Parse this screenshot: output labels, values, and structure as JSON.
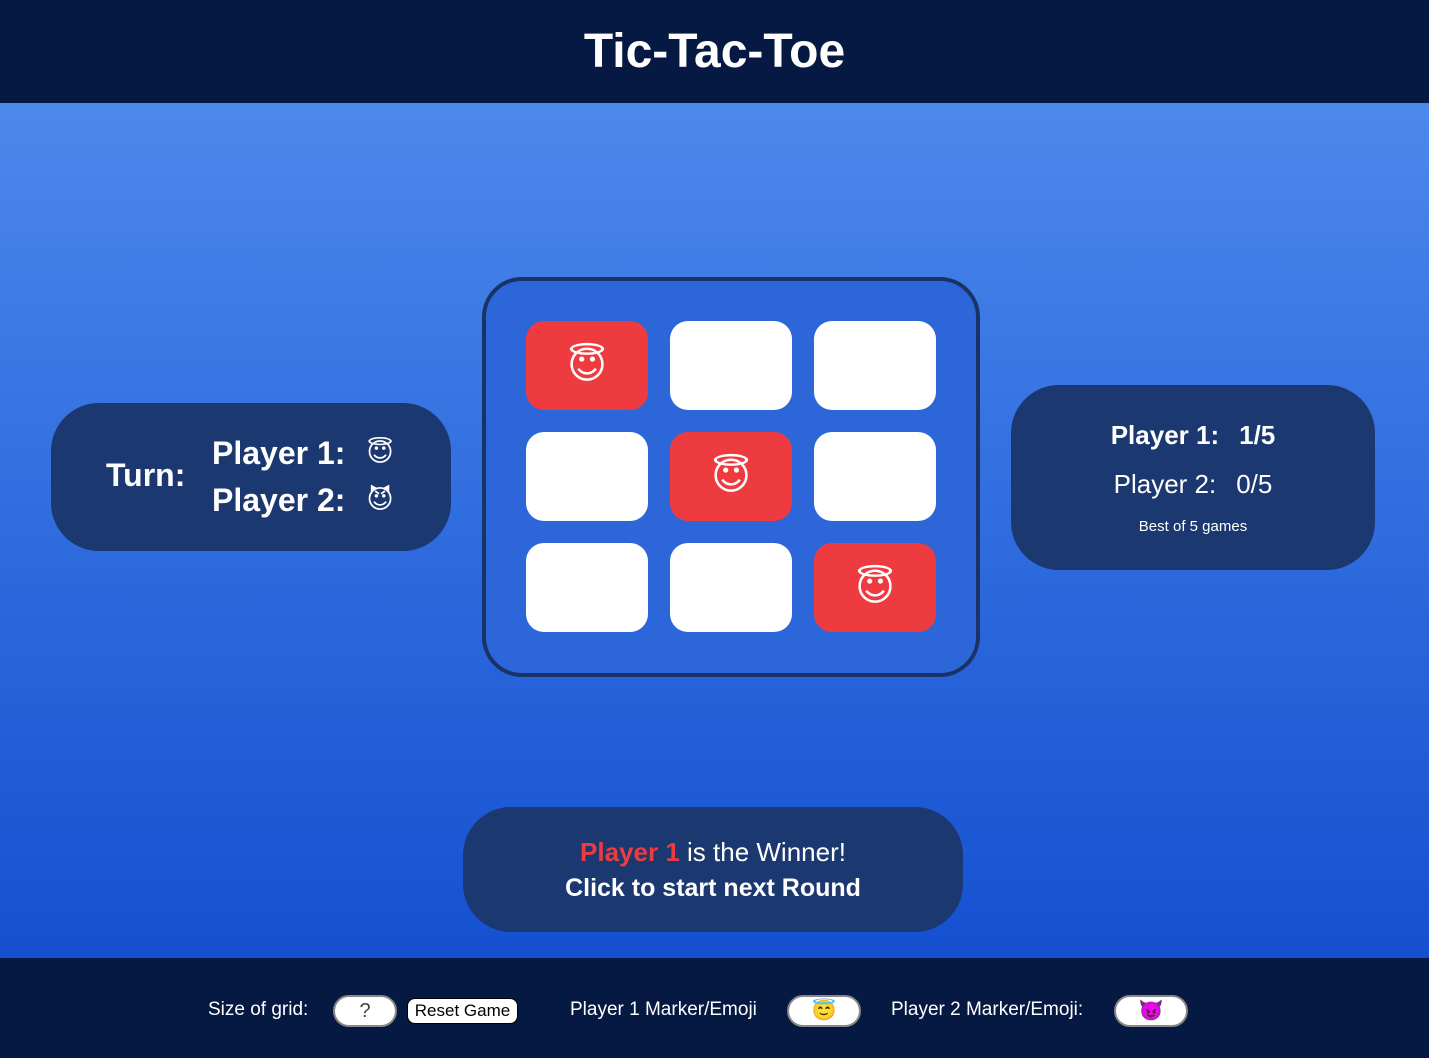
{
  "header": {
    "title": "Tic-Tac-Toe"
  },
  "turn": {
    "label": "Turn:",
    "players": [
      {
        "label": "Player 1:",
        "emoji": "😇"
      },
      {
        "label": "Player 2:",
        "emoji": "😈"
      }
    ]
  },
  "board": {
    "cells": [
      {
        "mark": "😇",
        "winning": true
      },
      {
        "mark": "",
        "winning": false
      },
      {
        "mark": "",
        "winning": false
      },
      {
        "mark": "😈",
        "winning": false
      },
      {
        "mark": "😇",
        "winning": true
      },
      {
        "mark": "",
        "winning": false
      },
      {
        "mark": "",
        "winning": false
      },
      {
        "mark": "😈",
        "winning": false
      },
      {
        "mark": "😇",
        "winning": true
      }
    ],
    "colors": {
      "empty": "#ffffff",
      "winning": "#ee3b3f"
    }
  },
  "score": {
    "p1_label": "Player 1:",
    "p1_value": "1/5",
    "p2_label": "Player 2:",
    "p2_value": "0/5",
    "best_of": "Best of 5 games"
  },
  "result": {
    "winner": "Player 1",
    "winner_suffix": " is the Winner!",
    "next_round": "Click to start next Round"
  },
  "footer": {
    "grid_size_label": "Size of grid:",
    "grid_size_value": "?",
    "reset_label": "Reset Game",
    "p1_marker_label": "Player 1 Marker/Emoji",
    "p1_marker_value": "😇",
    "p2_marker_label": "Player 2 Marker/Emoji:",
    "p2_marker_value": "😈"
  }
}
